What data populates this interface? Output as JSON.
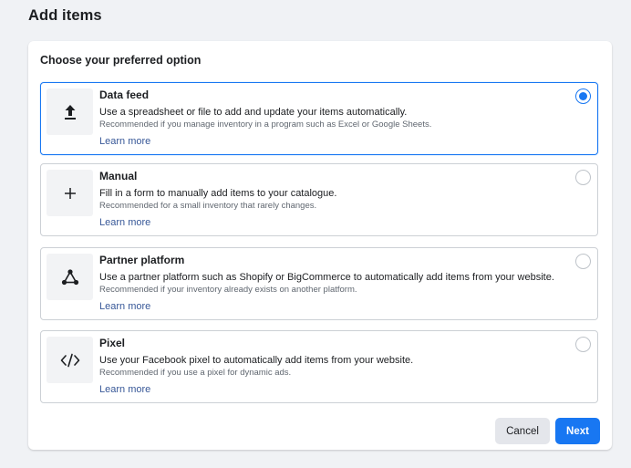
{
  "page": {
    "title": "Add items"
  },
  "panel": {
    "section_title": "Choose your preferred option"
  },
  "options": [
    {
      "name": "Data feed",
      "description": "Use a spreadsheet or file to add and update your items automatically.",
      "recommendation": "Recommended if you manage inventory in a program such as Excel or Google Sheets.",
      "link": "Learn more",
      "icon": "upload-icon",
      "selected": true
    },
    {
      "name": "Manual",
      "description": "Fill in a form to manually add items to your catalogue.",
      "recommendation": "Recommended for a small inventory that rarely changes.",
      "link": "Learn more",
      "icon": "plus-icon",
      "selected": false
    },
    {
      "name": "Partner platform",
      "description": "Use a partner platform such as Shopify or BigCommerce to automatically add items from your website.",
      "recommendation": "Recommended if your inventory already exists on another platform.",
      "link": "Learn more",
      "icon": "network-icon",
      "selected": false
    },
    {
      "name": "Pixel",
      "description": "Use your Facebook pixel to automatically add items from your website.",
      "recommendation": "Recommended if you use a pixel for dynamic ads.",
      "link": "Learn more",
      "icon": "code-icon",
      "selected": false
    }
  ],
  "footer": {
    "cancel_label": "Cancel",
    "next_label": "Next"
  },
  "colors": {
    "accent": "#1877f2",
    "link": "#385898",
    "background": "#f0f2f5"
  }
}
